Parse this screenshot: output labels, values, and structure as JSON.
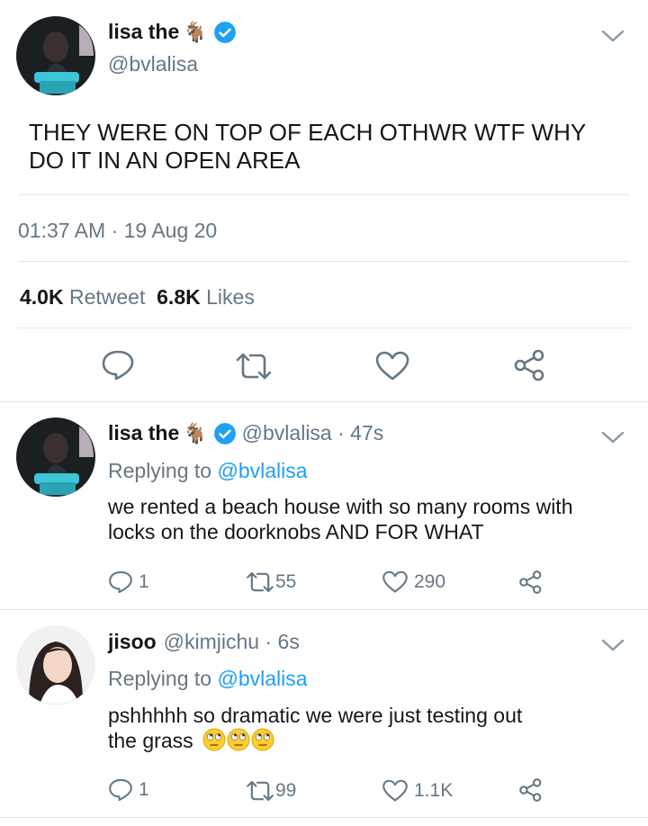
{
  "main_tweet": {
    "display_name": "lisa the",
    "name_emoji": "🐐",
    "handle": "@bvlalisa",
    "text_line1": "THEY WERE ON TOP OF EACH OTHWR WTF WHY",
    "text_line2": "DO IT IN AN OPEN AREA",
    "timestamp": "01:37 AM · 19 Aug 20",
    "retweet_count": "4.0K",
    "retweet_label": "Retweet",
    "like_count": "6.8K",
    "like_label": "Likes"
  },
  "replies": [
    {
      "display_name": "lisa the",
      "name_emoji": "🐐",
      "handle_time": "@bvlalisa · 47s",
      "replying_prefix": "Replying to",
      "replying_to": "@bvlalisa",
      "text_line1": "we rented a beach house with so many rooms with",
      "text_line2": "locks on the doorknobs AND FOR WHAT",
      "reply_count": "1",
      "retweet_count": "55",
      "like_count": "290"
    },
    {
      "display_name": "jisoo",
      "handle_time": "@kimjichu · 6s",
      "replying_prefix": "Replying to",
      "replying_to": "@bvlalisa",
      "text_line1": "pshhhhh so dramatic we were just testing out",
      "text_line2": "the grass",
      "text_emoji": "🙄🙄🙄",
      "reply_count": "1",
      "retweet_count": "99",
      "like_count": "1.1K"
    }
  ],
  "colors": {
    "accent": "#1da1f2",
    "secondary_text": "#657786",
    "divider": "#e1e8ed"
  },
  "icons": [
    "reply-icon",
    "retweet-icon",
    "like-icon",
    "share-icon",
    "verified-badge-icon",
    "chevron-down-icon"
  ]
}
